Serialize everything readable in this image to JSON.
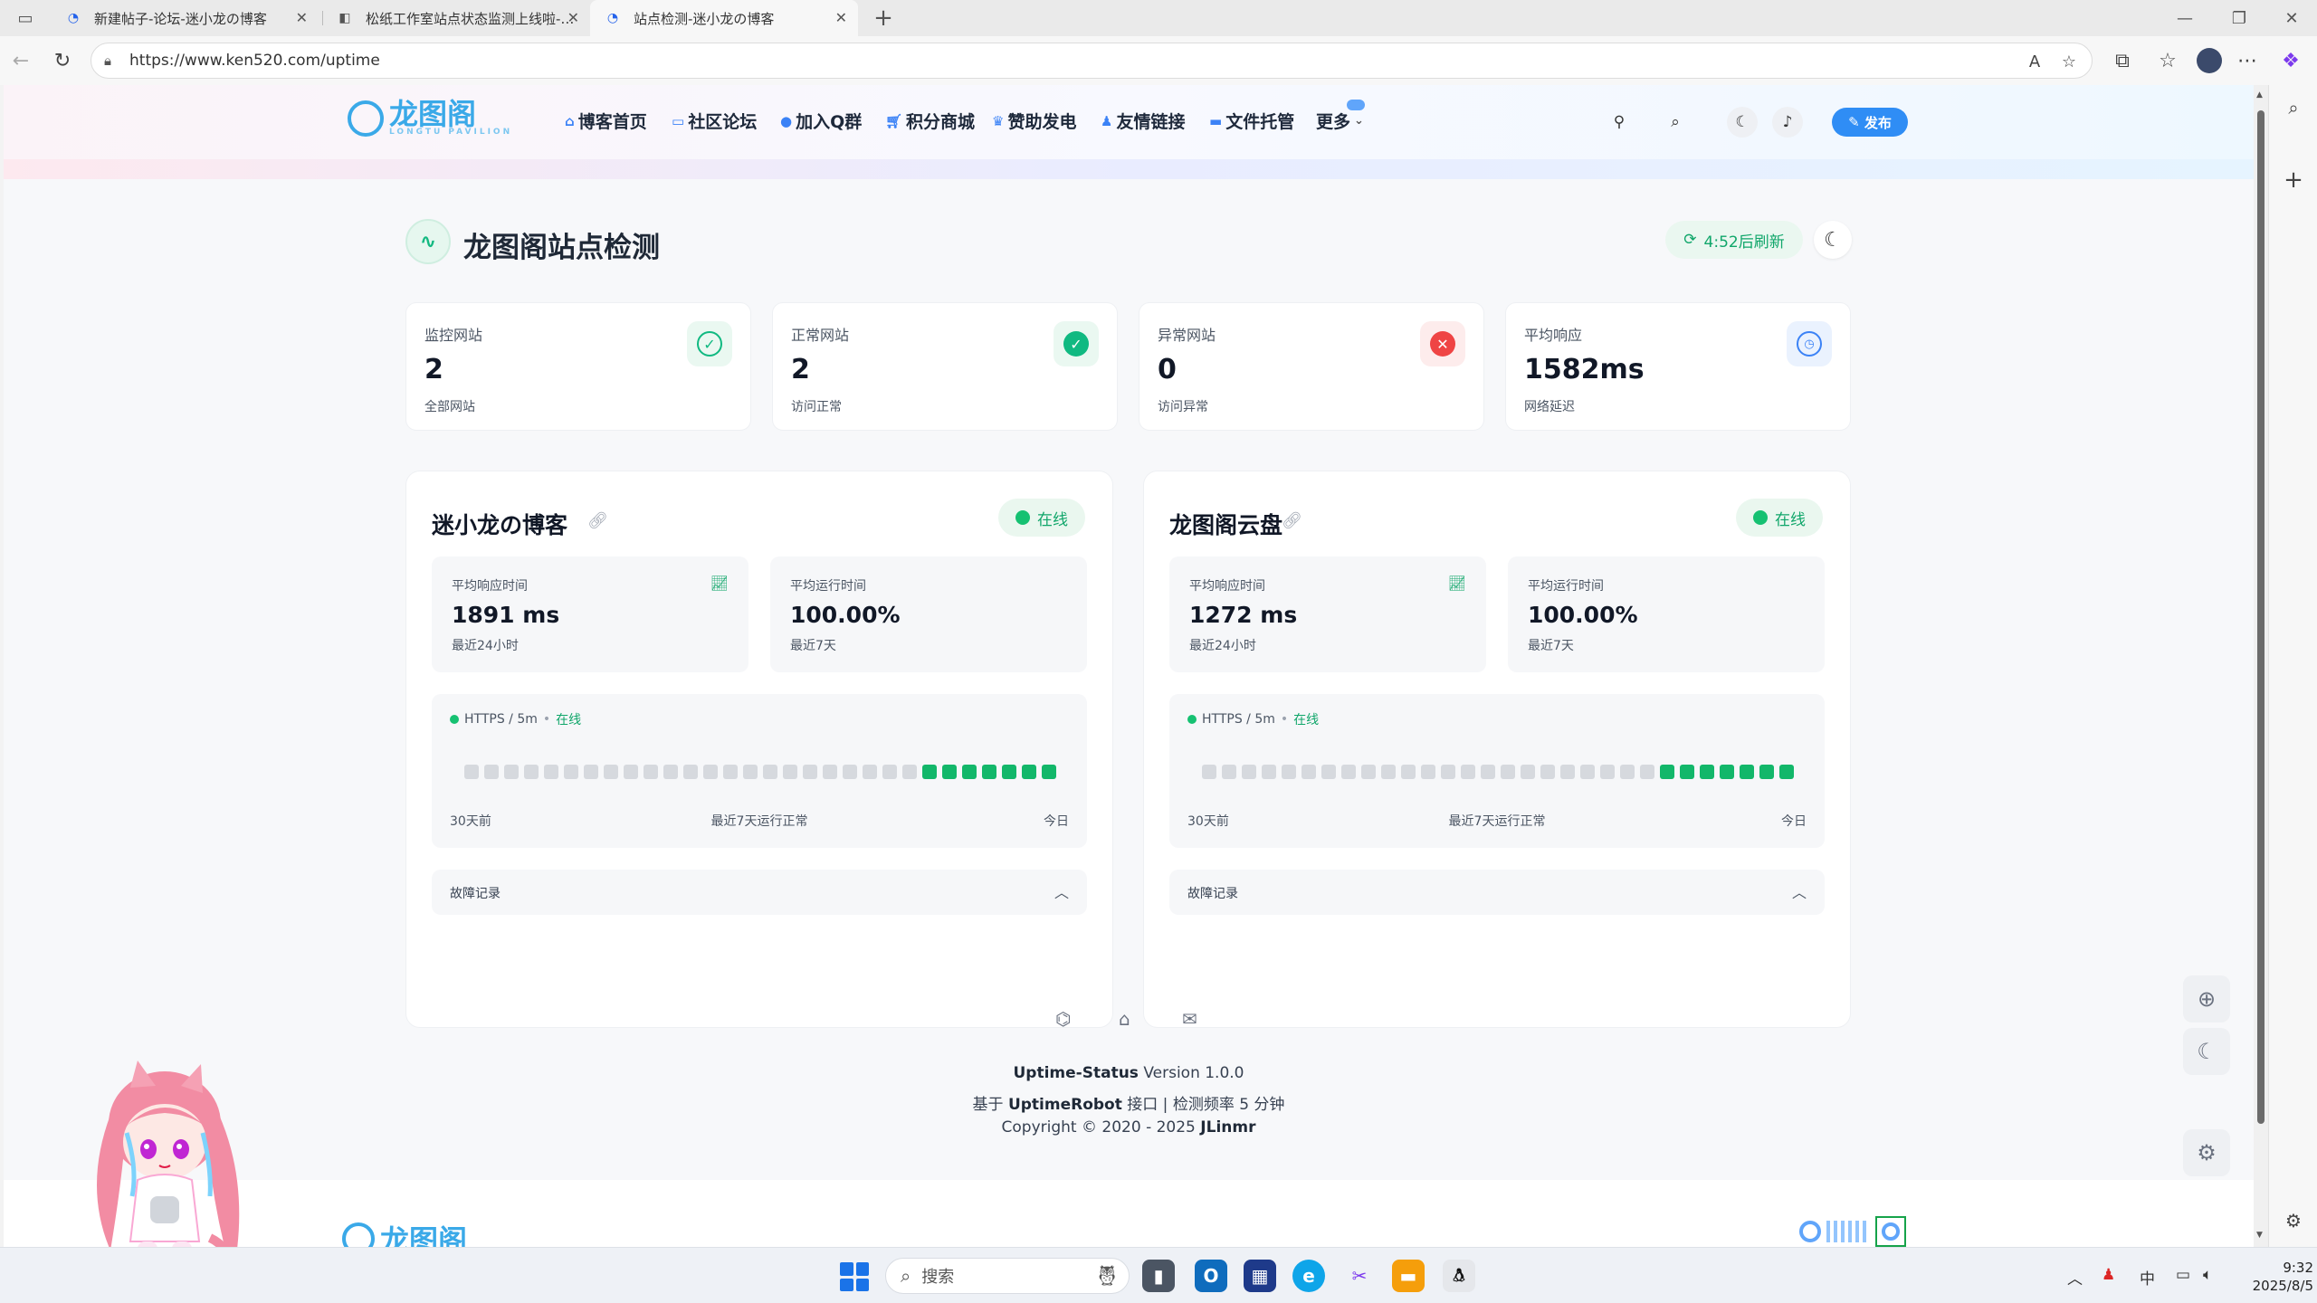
{
  "browser": {
    "tabs": [
      {
        "title": "新建帖子-论坛-迷小龙の博客"
      },
      {
        "title": "松纸工作室站点状态监测上线啦-…"
      },
      {
        "title": "站点检测-迷小龙の博客"
      }
    ],
    "url": "https://www.ken520.com/uptime"
  },
  "site": {
    "logo_text": "龙图阁",
    "logo_sub": "LONGTU PAVILION",
    "menu": [
      "博客首页",
      "社区论坛",
      "加入Q群",
      "积分商城",
      "赞助发电",
      "友情链接",
      "文件托管",
      "更多"
    ],
    "publish_label": "发布"
  },
  "page": {
    "title": "龙图阁站点检测",
    "refresh": "4:52后刷新"
  },
  "stats": [
    {
      "label": "监控网站",
      "value": "2",
      "sub": "全部网站",
      "icon": "check-circle-outline-icon",
      "color": "#10b981"
    },
    {
      "label": "正常网站",
      "value": "2",
      "sub": "访问正常",
      "icon": "check-circle-filled-icon",
      "color": "#10b981"
    },
    {
      "label": "异常网站",
      "value": "0",
      "sub": "访问异常",
      "icon": "x-circle-icon",
      "color": "#ef4444"
    },
    {
      "label": "平均响应",
      "value": "1582ms",
      "sub": "网络延迟",
      "icon": "clock-icon",
      "color": "#3b82f6"
    }
  ],
  "monitors": [
    {
      "name": "迷小龙の博客",
      "status": "在线",
      "avg_response_label": "平均响应时间",
      "avg_response": "1891 ms",
      "avg_response_sub": "最近24小时",
      "avg_uptime_label": "平均运行时间",
      "avg_uptime": "100.00%",
      "avg_uptime_sub": "最近7天",
      "check_type": "HTTPS / 5m",
      "check_status": "在线",
      "down_days": 23,
      "up_days": 7,
      "left_label": "30天前",
      "center_label": "最近7天运行正常",
      "right_label": "今日",
      "fault_label": "故障记录"
    },
    {
      "name": "龙图阁云盘",
      "status": "在线",
      "avg_response_label": "平均响应时间",
      "avg_response": "1272 ms",
      "avg_response_sub": "最近24小时",
      "avg_uptime_label": "平均运行时间",
      "avg_uptime": "100.00%",
      "avg_uptime_sub": "最近7天",
      "check_type": "HTTPS / 5m",
      "check_status": "在线",
      "down_days": 23,
      "up_days": 7,
      "left_label": "30天前",
      "center_label": "最近7天运行正常",
      "right_label": "今日",
      "fault_label": "故障记录"
    }
  ],
  "footer": {
    "line1_name": "Uptime-Status",
    "line1_rest": " Version 1.0.0",
    "line2_a": "基于 ",
    "line2_b": "UptimeRobot",
    "line2_c": " 接口 | 检测频率 5 分钟",
    "line3_a": "Copyright © 2020 - 2025 ",
    "line3_b": "JLinmr"
  },
  "taskbar": {
    "search_placeholder": "搜索",
    "ime": "中",
    "time": "9:32",
    "date": "2025/8/5"
  }
}
